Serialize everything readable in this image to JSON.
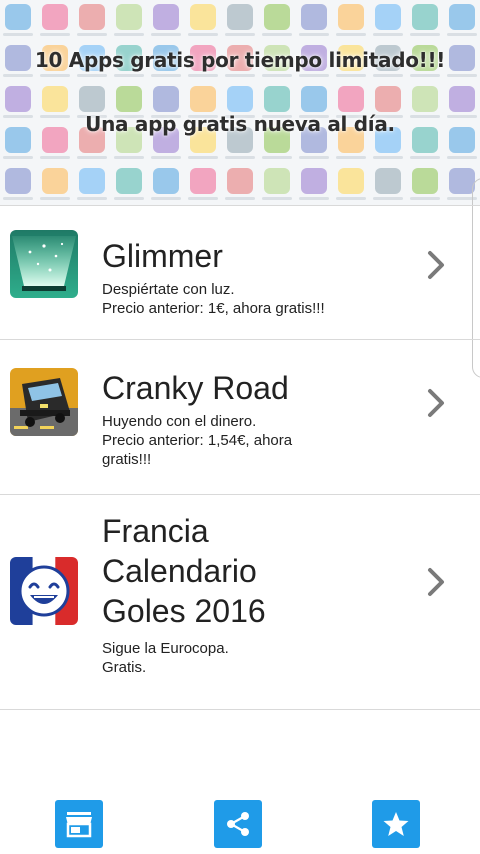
{
  "banner": {
    "line1": "10 Apps gratis por tiempo limitado!!!",
    "line2": "Una app gratis nueva al día."
  },
  "apps": [
    {
      "name": "Glimmer",
      "desc_line1": "Despiértate con luz.",
      "desc_line2": "Precio anterior: 1€, ahora gratis!!!"
    },
    {
      "name": "Cranky Road",
      "desc_line1": "Huyendo con el dinero.",
      "desc_line2": "Precio anterior: 1,54€, ahora gratis!!!"
    },
    {
      "name": "Francia Calendario Goles 2016",
      "desc_line1": "Sigue la Eurocopa.",
      "desc_line2": "Gratis."
    }
  ],
  "bottom_bar": {
    "buttons": [
      "store-icon",
      "share-icon",
      "star-icon"
    ]
  },
  "colors": {
    "accent": "#1f9be8",
    "divider": "#d9d9d9",
    "chevron": "#7a7a7a"
  }
}
